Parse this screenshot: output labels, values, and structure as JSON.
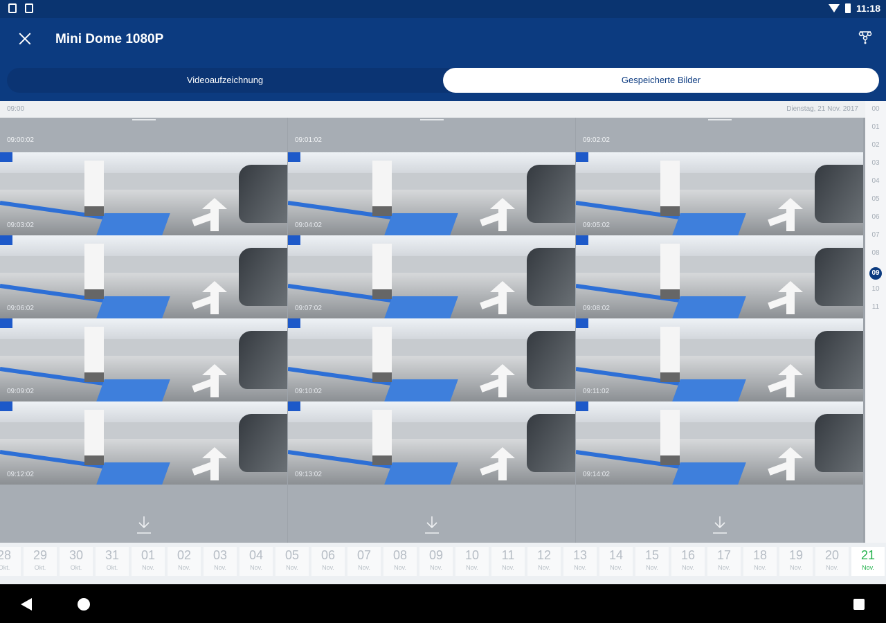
{
  "status": {
    "time": "11:18"
  },
  "app": {
    "title": "Mini Dome 1080P"
  },
  "tabs": [
    {
      "label": "Videoaufzeichnung",
      "selected": false
    },
    {
      "label": "Gespeicherte Bilder",
      "selected": true
    }
  ],
  "timeline": {
    "start_label": "09:00",
    "date_label": "Dienstag, 21 Nov. 2017"
  },
  "hours": [
    "00",
    "01",
    "02",
    "03",
    "04",
    "05",
    "06",
    "07",
    "08",
    "09",
    "10",
    "11"
  ],
  "active_hour": "09",
  "columns": [
    {
      "time": "09:00:02",
      "thumbs": [
        "09:03:02",
        "09:06:02",
        "09:09:02",
        "09:12:02"
      ]
    },
    {
      "time": "09:01:02",
      "thumbs": [
        "09:04:02",
        "09:07:02",
        "09:10:02",
        "09:13:02"
      ]
    },
    {
      "time": "09:02:02",
      "thumbs": [
        "09:05:02",
        "09:08:02",
        "09:11:02",
        "09:14:02"
      ]
    }
  ],
  "dates": [
    {
      "day": "28",
      "month": "Okt."
    },
    {
      "day": "29",
      "month": "Okt."
    },
    {
      "day": "30",
      "month": "Okt."
    },
    {
      "day": "31",
      "month": "Okt."
    },
    {
      "day": "01",
      "month": "Nov."
    },
    {
      "day": "02",
      "month": "Nov."
    },
    {
      "day": "03",
      "month": "Nov."
    },
    {
      "day": "04",
      "month": "Nov."
    },
    {
      "day": "05",
      "month": "Nov."
    },
    {
      "day": "06",
      "month": "Nov."
    },
    {
      "day": "07",
      "month": "Nov."
    },
    {
      "day": "08",
      "month": "Nov."
    },
    {
      "day": "09",
      "month": "Nov."
    },
    {
      "day": "10",
      "month": "Nov."
    },
    {
      "day": "11",
      "month": "Nov."
    },
    {
      "day": "12",
      "month": "Nov."
    },
    {
      "day": "13",
      "month": "Nov."
    },
    {
      "day": "14",
      "month": "Nov."
    },
    {
      "day": "15",
      "month": "Nov."
    },
    {
      "day": "16",
      "month": "Nov."
    },
    {
      "day": "17",
      "month": "Nov."
    },
    {
      "day": "18",
      "month": "Nov."
    },
    {
      "day": "19",
      "month": "Nov."
    },
    {
      "day": "20",
      "month": "Nov."
    },
    {
      "day": "21",
      "month": "Nov."
    }
  ],
  "active_date": "21",
  "icons": {
    "close": "close-icon",
    "network": "network-icon",
    "download": "download-icon"
  },
  "colors": {
    "header": "#0c3b80",
    "active_date": "#24b24d",
    "active_hour": "#0c3b80"
  }
}
